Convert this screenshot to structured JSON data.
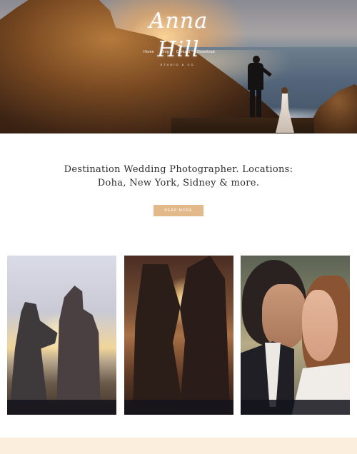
{
  "header": {
    "logo": {
      "name": "Anna Hill",
      "tagline": "STUDIO & CO."
    },
    "nav": [
      {
        "label": "Home"
      },
      {
        "label": "Blog"
      },
      {
        "label": "Contact"
      },
      {
        "label": "Download"
      }
    ]
  },
  "intro": {
    "line1": "Destination Wedding Photographer. Locations:",
    "line2": "Doha, New York, Sidney & more.",
    "cta_label": "READ MORE"
  },
  "gallery": {
    "photos": [
      {
        "icon": "couple-dancing-sunset-photo"
      },
      {
        "icon": "couple-silhouette-backlit-photo"
      },
      {
        "icon": "couple-closeup-portrait-photo"
      }
    ]
  },
  "colors": {
    "accent": "#e3b98a",
    "footer_strip": "#fbeedc",
    "text": "#2c2c2c",
    "photo_bar": "#14141c"
  }
}
